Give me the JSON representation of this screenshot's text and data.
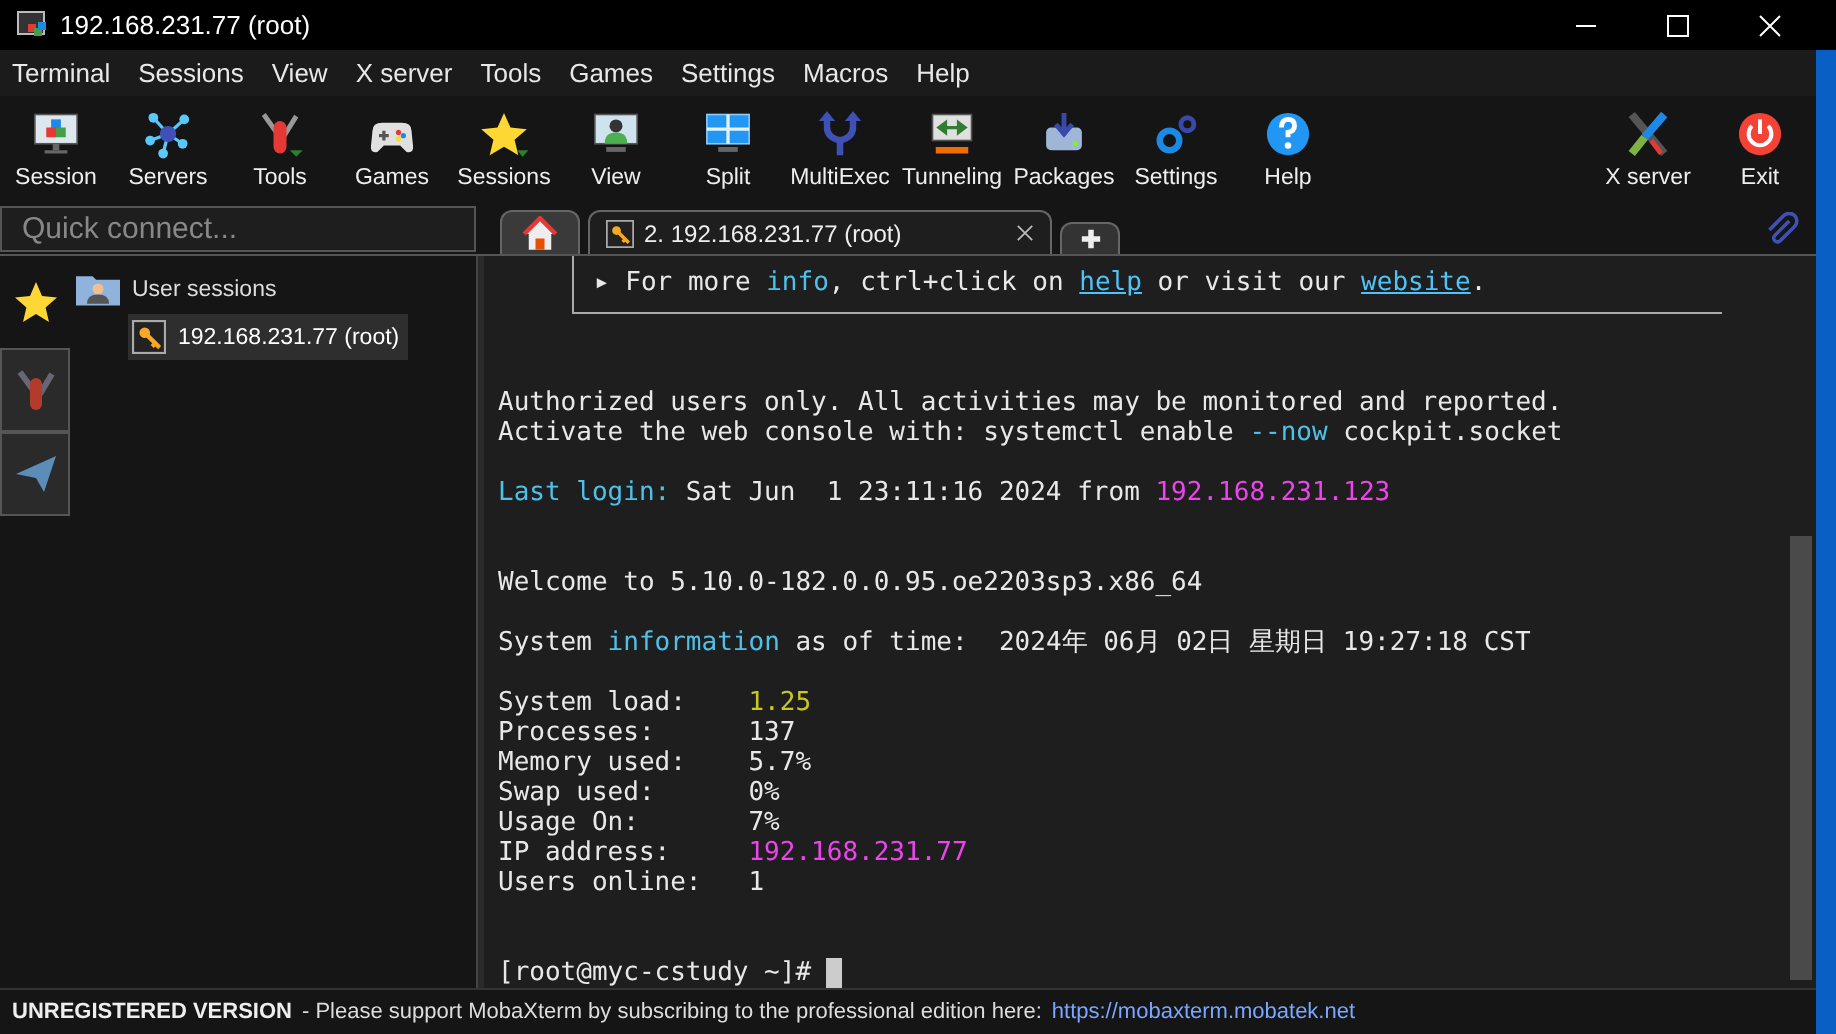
{
  "window": {
    "title": "192.168.231.77 (root)"
  },
  "menu": [
    "Terminal",
    "Sessions",
    "View",
    "X server",
    "Tools",
    "Games",
    "Settings",
    "Macros",
    "Help"
  ],
  "toolbar": [
    {
      "label": "Session",
      "kind": "session"
    },
    {
      "label": "Servers",
      "kind": "servers"
    },
    {
      "label": "Tools",
      "kind": "tools"
    },
    {
      "label": "Games",
      "kind": "games"
    },
    {
      "label": "Sessions",
      "kind": "sessions"
    },
    {
      "label": "View",
      "kind": "view"
    },
    {
      "label": "Split",
      "kind": "split"
    },
    {
      "label": "MultiExec",
      "kind": "multiexec"
    },
    {
      "label": "Tunneling",
      "kind": "tunneling"
    },
    {
      "label": "Packages",
      "kind": "packages"
    },
    {
      "label": "Settings",
      "kind": "settings"
    },
    {
      "label": "Help",
      "kind": "help"
    }
  ],
  "toolbar_right": [
    {
      "label": "X server",
      "kind": "xserver"
    },
    {
      "label": "Exit",
      "kind": "exit"
    }
  ],
  "quick_connect": {
    "placeholder": "Quick connect..."
  },
  "tabs": [
    {
      "kind": "home",
      "selected": false
    },
    {
      "kind": "session",
      "label": "2. 192.168.231.77 (root)",
      "selected": true
    },
    {
      "kind": "new",
      "selected": false
    }
  ],
  "side_tabs": [
    {
      "kind": "sessions",
      "selected": true
    },
    {
      "kind": "tools",
      "selected": false
    },
    {
      "kind": "macros",
      "selected": false
    }
  ],
  "sessions_tree": {
    "label": "User sessions",
    "children": [
      {
        "label": "192.168.231.77 (root)",
        "selected": true
      }
    ]
  },
  "terminal": {
    "banner": [
      {
        "t": "▸ ",
        "kind": "plain"
      },
      {
        "t": "For more ",
        "kind": "plain"
      },
      {
        "t": "info",
        "kind": "cyan"
      },
      {
        "t": ", ctrl+click on ",
        "kind": "plain"
      },
      {
        "t": "help",
        "kind": "link"
      },
      {
        "t": " or visit our ",
        "kind": "plain"
      },
      {
        "t": "website",
        "kind": "link"
      },
      {
        "t": ".",
        "kind": "plain"
      }
    ],
    "lines": [
      {
        "kind": "blank"
      },
      {
        "kind": "blank"
      },
      {
        "kind": "text",
        "segments": [
          {
            "t": "Authorized users only. All activities may be monitored and reported.",
            "kind": "plain"
          }
        ]
      },
      {
        "kind": "text",
        "segments": [
          {
            "t": "Activate the web console with: systemctl enable ",
            "kind": "plain"
          },
          {
            "t": "--now",
            "kind": "cyan"
          },
          {
            "t": " cockpit.socket",
            "kind": "plain"
          }
        ]
      },
      {
        "kind": "blank"
      },
      {
        "kind": "text",
        "segments": [
          {
            "t": "Last login:",
            "kind": "cyan"
          },
          {
            "t": " Sat Jun  1 23:11:16 2024 from ",
            "kind": "plain"
          },
          {
            "t": "192.168.231.123",
            "kind": "magenta"
          }
        ]
      },
      {
        "kind": "blank"
      },
      {
        "kind": "blank"
      },
      {
        "kind": "text",
        "segments": [
          {
            "t": "Welcome to 5.10.0-182.0.0.95.oe2203sp3.x86_64",
            "kind": "plain"
          }
        ]
      },
      {
        "kind": "blank"
      },
      {
        "kind": "text",
        "segments": [
          {
            "t": "System ",
            "kind": "plain"
          },
          {
            "t": "information",
            "kind": "cyan"
          },
          {
            "t": " as of time:  2024年 06月 02日 星期日 19:27:18 CST",
            "kind": "plain"
          }
        ]
      },
      {
        "kind": "blank"
      },
      {
        "kind": "text",
        "segments": [
          {
            "t": "System load:    ",
            "kind": "plain"
          },
          {
            "t": "1.25",
            "kind": "yellow"
          }
        ]
      },
      {
        "kind": "text",
        "segments": [
          {
            "t": "Processes:      137",
            "kind": "plain"
          }
        ]
      },
      {
        "kind": "text",
        "segments": [
          {
            "t": "Memory used:    5.7%",
            "kind": "plain"
          }
        ]
      },
      {
        "kind": "text",
        "segments": [
          {
            "t": "Swap used:      0%",
            "kind": "plain"
          }
        ]
      },
      {
        "kind": "text",
        "segments": [
          {
            "t": "Usage On:       7%",
            "kind": "plain"
          }
        ]
      },
      {
        "kind": "text",
        "segments": [
          {
            "t": "IP address:     ",
            "kind": "plain"
          },
          {
            "t": "192.168.231.77",
            "kind": "magenta"
          }
        ]
      },
      {
        "kind": "text",
        "segments": [
          {
            "t": "Users online:   1",
            "kind": "plain"
          }
        ]
      },
      {
        "kind": "blank"
      },
      {
        "kind": "blank"
      },
      {
        "kind": "prompt",
        "segments": [
          {
            "t": "[root@myc-cstudy ~]# ",
            "kind": "plain"
          }
        ]
      }
    ]
  },
  "status_bar": {
    "badge": "UNREGISTERED VERSION",
    "message": "-  Please support MobaXterm by subscribing to the professional edition here:",
    "link": "https://mobaxterm.mobatek.net"
  }
}
